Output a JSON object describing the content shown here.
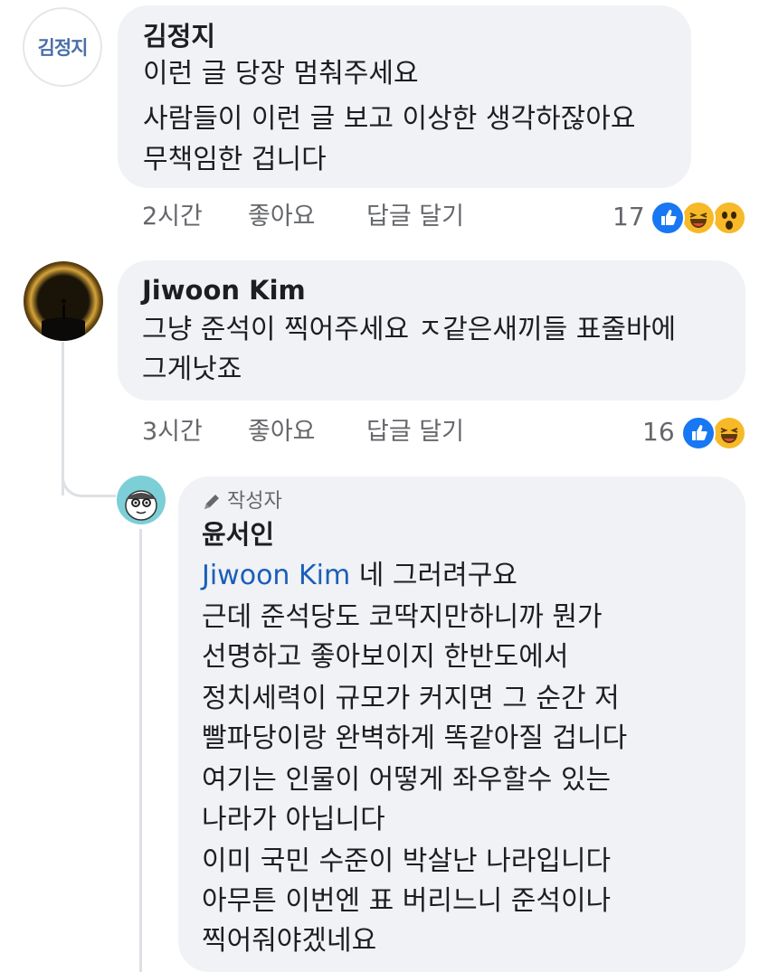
{
  "comments": [
    {
      "avatar_text": "김정지",
      "author": "김정지",
      "lines": [
        "이런 글 당장 멈춰주세요",
        "사람들이 이런 글 보고 이상한 생각하잖아요",
        "무책임한 겁니다"
      ],
      "time": "2시간",
      "like_label": "좋아요",
      "reply_label": "답글 달기",
      "reaction_count": "17",
      "reactions": [
        "like-icon",
        "haha-icon",
        "wow-icon"
      ]
    },
    {
      "author": "Jiwoon Kim",
      "lines": [
        "그냥 준석이 찍어주세요 ㅈ같은새끼들 표줄바에",
        "그게낫죠"
      ],
      "time": "3시간",
      "like_label": "좋아요",
      "reply_label": "답글 달기",
      "reaction_count": "16",
      "reactions": [
        "like-icon",
        "haha-icon"
      ]
    }
  ],
  "reply": {
    "badge": "작성자",
    "badge_icon": "pencil-icon",
    "author": "윤서인",
    "mention": "Jiwoon Kim",
    "first_line_rest": "네 그러려구요",
    "lines": [
      "근데 준석당도 코딱지만하니까 뭔가",
      "선명하고 좋아보이지 한반도에서",
      "정치세력이 규모가 커지면 그 순간 저",
      "빨파당이랑 완벽하게 똑같아질 겁니다",
      "여기는 인물이 어떻게 좌우할수 있는",
      "나라가 아닙니다",
      "이미 국민 수준이 박살난 나라입니다",
      "아무튼 이번엔 표 버리느니 준석이나",
      "찍어줘야겠네요"
    ]
  },
  "colors": {
    "bubble": "#f0f2f5",
    "meta_text": "#65676b",
    "mention": "#1b5fb8",
    "like_blue": "#1877f2",
    "emoji_yellow": "#f7b928",
    "thread_line": "#dde0e4"
  }
}
